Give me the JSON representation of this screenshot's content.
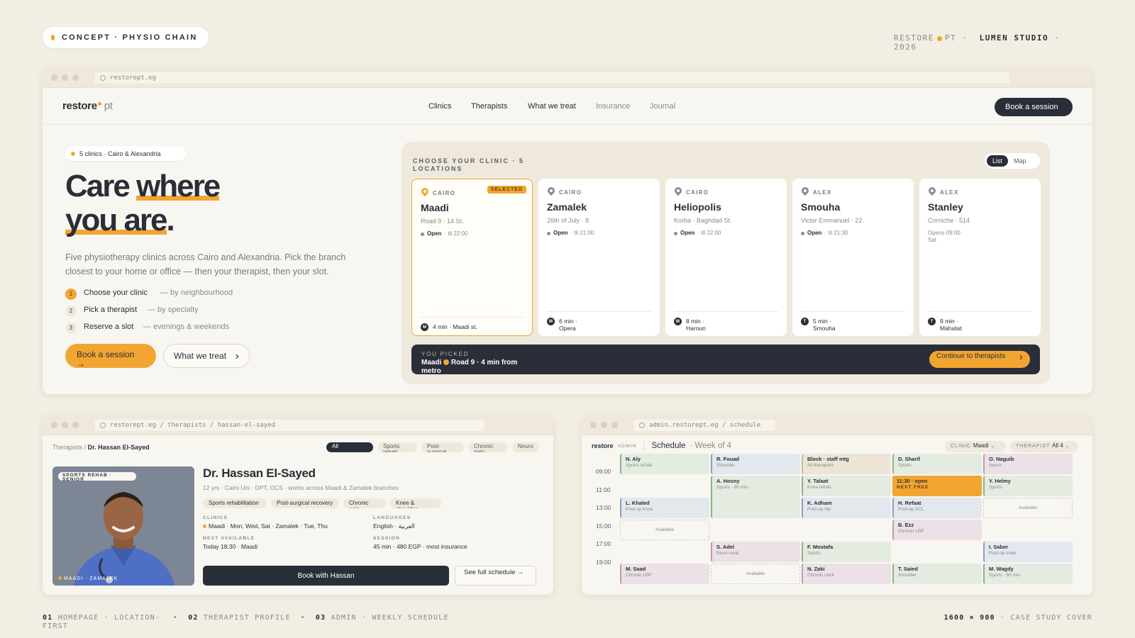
{
  "concept_label": "CONCEPT · PHYSIO CHAIN",
  "brand_top": {
    "left": "RESTORE",
    "mid": "PT  ·",
    "studio": "LUMEN STUDIO",
    "year": "· 2026"
  },
  "main": {
    "url": "restorept.eg",
    "logo": {
      "word": "restore",
      "suffix": "pt"
    },
    "nav": [
      "Clinics",
      "Therapists",
      "What we treat",
      "Insurance",
      "Journal"
    ],
    "nav_cta": "Book a session",
    "tag": "5 clinics · Cairo & Alexandria",
    "headline": {
      "a": "Care ",
      "b": "where",
      "c": "you are",
      "d": "."
    },
    "desc": "Five physiotherapy clinics across Cairo and Alexandria. Pick the branch closest to your home or office — then your therapist, then your slot.",
    "steps": [
      {
        "n": "1",
        "label": "Choose your clinic",
        "detail": "— by neighbourhood"
      },
      {
        "n": "2",
        "label": "Pick a therapist",
        "detail": "— by specialty"
      },
      {
        "n": "3",
        "label": "Reserve a slot",
        "detail": "— evenings & weekends"
      }
    ],
    "cta_primary": "Book a session →",
    "cta_secondary": "What we treat",
    "panel_title": "CHOOSE YOUR CLINIC · 5 LOCATIONS",
    "view_toggle": {
      "list": "List",
      "map": "Map"
    },
    "selected_badge": "SELECTED",
    "clinics": [
      {
        "city": "CAIRO",
        "name": "Maadi",
        "addr": "Road 9 · 14 St.",
        "status": "Open",
        "hours": "· til 22:00",
        "metro_icon": "M",
        "metro": "4 min · Maadi st."
      },
      {
        "city": "CAIRO",
        "name": "Zamalek",
        "addr": "26th of July · 8",
        "status": "Open",
        "hours": "· til 21:00",
        "metro_icon": "M",
        "metro": "6 min · Opera"
      },
      {
        "city": "CAIRO",
        "name": "Heliopolis",
        "addr": "Korba · Baghdad St.",
        "status": "Open",
        "hours": "· til 22:00",
        "metro_icon": "M",
        "metro": "8 min · Haroun"
      },
      {
        "city": "ALEX",
        "name": "Smouha",
        "addr": "Victor Emmanuel · 22",
        "status": "Open",
        "hours": "· til 21:30",
        "metro_icon": "T",
        "metro": "5 min · Smouha"
      },
      {
        "city": "ALEX",
        "name": "Stanley",
        "addr": "Corniche · 514",
        "status": "",
        "hours": "Opens 09:00 Sat",
        "metro_icon": "T",
        "metro": "9 min · Mahatat"
      }
    ],
    "picked": {
      "label": "YOU PICKED",
      "name": "Maadi",
      "detail": "Road 9 · 4 min from metro",
      "cta": "Continue to therapists"
    }
  },
  "therapist": {
    "url": "restorept.eg / therapists / hassan-el-sayed",
    "crumb": {
      "root": "Therapists",
      "sep": "/",
      "current": "Dr. Hassan El-Sayed"
    },
    "filters": [
      "All",
      "Sports rehab",
      "Post-surgical",
      "Chronic pain",
      "Neuro"
    ],
    "photo_label": "SPORTS REHAB · SENIOR",
    "photo_footer": "MAADI · ZAMALEK",
    "name": "Dr. Hassan El-Sayed",
    "sub": "12 yrs · Cairo Uni · DPT, OCS · works across Maadi & Zamalek branches",
    "chips": [
      "Sports rehabilitation",
      "Post-surgical recovery",
      "Chronic pain",
      "Knee & shoulder"
    ],
    "clinics_k": "CLINICS",
    "clinics_v": "Maadi · Mon, Wed, Sat  ·  Zamalek · Tue, Thu",
    "languages_k": "LANGUAGES",
    "languages_v": "English  ·  العربية",
    "next_k": "NEXT AVAILABLE",
    "next_v": "Today 18:30 · Maadi",
    "session_k": "SESSION",
    "session_v": "45 min · 480 EGP · most insurance",
    "book": "Book with Hassan",
    "schedule": "See full schedule →"
  },
  "admin": {
    "url": "admin.restorept.eg / schedule",
    "brand": "restore",
    "role": "ADMIN",
    "title": "Schedule",
    "week": "· Week of 4",
    "clinic_label": "CLINIC",
    "clinic_value": "Maadi",
    "therapist_label": "THERAPIST",
    "therapist_value": "All 4",
    "times": [
      "09:00",
      "11:00",
      "13:00",
      "15:00",
      "17:00",
      "19:00"
    ],
    "events": [
      {
        "col": 0,
        "row": 0,
        "rows": 1,
        "color": "green",
        "name": "N. Aly",
        "sub": "Sports rehab"
      },
      {
        "col": 0,
        "row": 2,
        "rows": 1,
        "color": "blue",
        "name": "L. Khaled",
        "sub": "Post-op knee"
      },
      {
        "col": 0,
        "row": 3,
        "rows": 1,
        "color": "avail",
        "name": "",
        "sub": "Available"
      },
      {
        "col": 0,
        "row": 5,
        "rows": 1,
        "color": "pink",
        "name": "M. Saad",
        "sub": "Chronic LBP"
      },
      {
        "col": 1,
        "row": 0,
        "rows": 1,
        "color": "blue",
        "name": "R. Fouad",
        "sub": "Shoulder"
      },
      {
        "col": 1,
        "row": 1,
        "rows": 2,
        "color": "green",
        "name": "A. Hosny",
        "sub": "Sports · 90 min"
      },
      {
        "col": 1,
        "row": 4,
        "rows": 1,
        "color": "pink",
        "name": "S. Adel",
        "sub": "Neuro eval"
      },
      {
        "col": 1,
        "row": 5,
        "rows": 1,
        "color": "avail",
        "name": "",
        "sub": "Available"
      },
      {
        "col": 2,
        "row": 0,
        "rows": 1,
        "color": "tan",
        "name": "Block · staff mtg",
        "sub": "All therapists"
      },
      {
        "col": 2,
        "row": 1,
        "rows": 1,
        "color": "green",
        "name": "Y. Talaat",
        "sub": "Knee rehab"
      },
      {
        "col": 2,
        "row": 2,
        "rows": 1,
        "color": "blue",
        "name": "K. Adham",
        "sub": "Post-op hip"
      },
      {
        "col": 2,
        "row": 4,
        "rows": 1,
        "color": "green",
        "name": "F. Mostafa",
        "sub": "Sports"
      },
      {
        "col": 2,
        "row": 5,
        "rows": 1,
        "color": "pink",
        "name": "N. Zaki",
        "sub": "Chronic neck"
      },
      {
        "col": 3,
        "row": 0,
        "rows": 1,
        "color": "green",
        "name": "D. Sharif",
        "sub": "Sports"
      },
      {
        "col": 3,
        "row": 1,
        "rows": 1,
        "color": "orange",
        "name": "11:30 · open",
        "sub": "NEXT FREE"
      },
      {
        "col": 3,
        "row": 2,
        "rows": 1,
        "color": "blue",
        "name": "H. Refaat",
        "sub": "Post-op ACL"
      },
      {
        "col": 3,
        "row": 3,
        "rows": 1,
        "color": "pink",
        "name": "B. Ezz",
        "sub": "Chronic LBP"
      },
      {
        "col": 3,
        "row": 5,
        "rows": 1,
        "color": "green",
        "name": "T. Saied",
        "sub": "Shoulder"
      },
      {
        "col": 4,
        "row": 0,
        "rows": 1,
        "color": "pink",
        "name": "O. Naguib",
        "sub": "Neuro"
      },
      {
        "col": 4,
        "row": 1,
        "rows": 1,
        "color": "green",
        "name": "Y. Helmy",
        "sub": "Sports"
      },
      {
        "col": 4,
        "row": 2,
        "rows": 1,
        "color": "avail",
        "name": "",
        "sub": "Available"
      },
      {
        "col": 4,
        "row": 4,
        "rows": 1,
        "color": "blue",
        "name": "I. Saber",
        "sub": "Post-op knee"
      },
      {
        "col": 4,
        "row": 5,
        "rows": 1,
        "color": "green",
        "name": "M. Wagdy",
        "sub": "Sports · 60 min"
      }
    ]
  },
  "footer": {
    "items": [
      {
        "n": "01",
        "label": "HOMEPAGE · LOCATION-FIRST"
      },
      {
        "n": "02",
        "label": "THERAPIST PROFILE"
      },
      {
        "n": "03",
        "label": "ADMIN · WEEKLY SCHEDULE"
      }
    ],
    "size": "1600 × 900",
    "right": "· CASE STUDY COVER"
  }
}
